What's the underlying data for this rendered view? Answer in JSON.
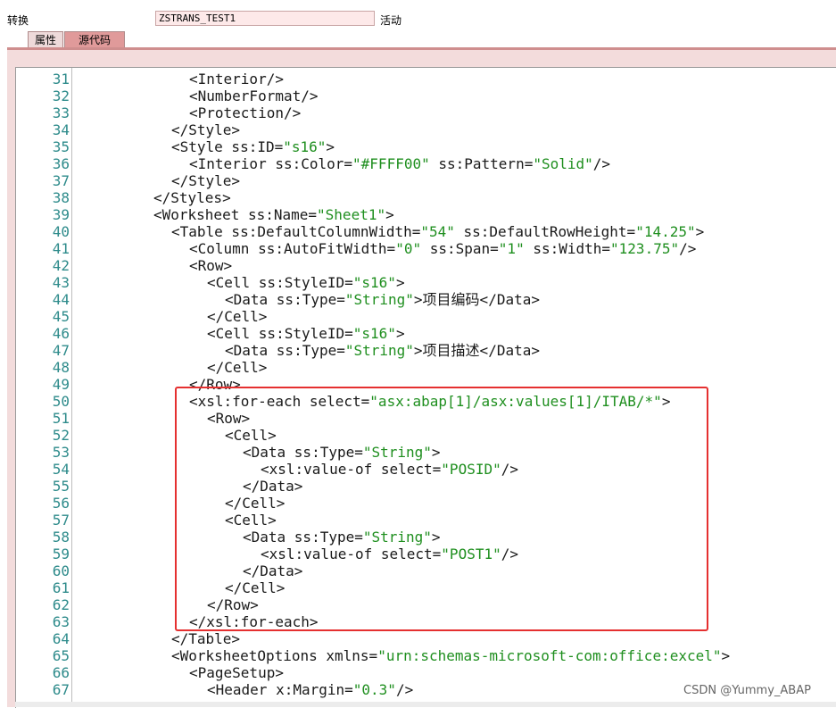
{
  "header": {
    "field_label": "转换",
    "name_value": "ZSTRANS_TEST1",
    "status": "活动"
  },
  "tabs": [
    {
      "label": "属性"
    },
    {
      "label": "源代码"
    }
  ],
  "colors": {
    "string_literal": "#1f8f1f",
    "line_number": "#2e8b8b",
    "highlight_box": "#e53030",
    "tab_active": "#e09a9a"
  },
  "code_lines": [
    {
      "n": "31",
      "indent": 6,
      "parts": [
        [
          "t",
          "<Interior/>"
        ]
      ]
    },
    {
      "n": "32",
      "indent": 6,
      "parts": [
        [
          "t",
          "<NumberFormat/>"
        ]
      ]
    },
    {
      "n": "33",
      "indent": 6,
      "parts": [
        [
          "t",
          "<Protection/>"
        ]
      ]
    },
    {
      "n": "34",
      "indent": 5,
      "parts": [
        [
          "t",
          "</Style>"
        ]
      ]
    },
    {
      "n": "35",
      "indent": 5,
      "parts": [
        [
          "t",
          "<Style ss:ID="
        ],
        [
          "s",
          "\"s16\""
        ],
        [
          "t",
          ">"
        ]
      ]
    },
    {
      "n": "36",
      "indent": 6,
      "parts": [
        [
          "t",
          "<Interior ss:Color="
        ],
        [
          "s",
          "\"#FFFF00\""
        ],
        [
          "t",
          " ss:Pattern="
        ],
        [
          "s",
          "\"Solid\""
        ],
        [
          "t",
          "/>"
        ]
      ]
    },
    {
      "n": "37",
      "indent": 5,
      "parts": [
        [
          "t",
          "</Style>"
        ]
      ]
    },
    {
      "n": "38",
      "indent": 4,
      "parts": [
        [
          "t",
          "</Styles>"
        ]
      ]
    },
    {
      "n": "39",
      "indent": 4,
      "parts": [
        [
          "t",
          "<Worksheet ss:Name="
        ],
        [
          "s",
          "\"Sheet1\""
        ],
        [
          "t",
          ">"
        ]
      ]
    },
    {
      "n": "40",
      "indent": 5,
      "parts": [
        [
          "t",
          "<Table ss:DefaultColumnWidth="
        ],
        [
          "s",
          "\"54\""
        ],
        [
          "t",
          " ss:DefaultRowHeight="
        ],
        [
          "s",
          "\"14.25\""
        ],
        [
          "t",
          ">"
        ]
      ]
    },
    {
      "n": "41",
      "indent": 6,
      "parts": [
        [
          "t",
          "<Column ss:AutoFitWidth="
        ],
        [
          "s",
          "\"0\""
        ],
        [
          "t",
          " ss:Span="
        ],
        [
          "s",
          "\"1\""
        ],
        [
          "t",
          " ss:Width="
        ],
        [
          "s",
          "\"123.75\""
        ],
        [
          "t",
          "/>"
        ]
      ]
    },
    {
      "n": "42",
      "indent": 6,
      "parts": [
        [
          "t",
          "<Row>"
        ]
      ]
    },
    {
      "n": "43",
      "indent": 7,
      "parts": [
        [
          "t",
          "<Cell ss:StyleID="
        ],
        [
          "s",
          "\"s16\""
        ],
        [
          "t",
          ">"
        ]
      ]
    },
    {
      "n": "44",
      "indent": 8,
      "parts": [
        [
          "t",
          "<Data ss:Type="
        ],
        [
          "s",
          "\"String\""
        ],
        [
          "t",
          ">项目编码</Data>"
        ]
      ]
    },
    {
      "n": "45",
      "indent": 7,
      "parts": [
        [
          "t",
          "</Cell>"
        ]
      ]
    },
    {
      "n": "46",
      "indent": 7,
      "parts": [
        [
          "t",
          "<Cell ss:StyleID="
        ],
        [
          "s",
          "\"s16\""
        ],
        [
          "t",
          ">"
        ]
      ]
    },
    {
      "n": "47",
      "indent": 8,
      "parts": [
        [
          "t",
          "<Data ss:Type="
        ],
        [
          "s",
          "\"String\""
        ],
        [
          "t",
          ">项目描述</Data>"
        ]
      ]
    },
    {
      "n": "48",
      "indent": 7,
      "parts": [
        [
          "t",
          "</Cell>"
        ]
      ]
    },
    {
      "n": "49",
      "indent": 6,
      "parts": [
        [
          "t",
          "</Row>"
        ]
      ]
    },
    {
      "n": "50",
      "indent": 6,
      "parts": [
        [
          "t",
          "<xsl:for-each select="
        ],
        [
          "s",
          "\"asx:abap[1]/asx:values[1]/ITAB/*\""
        ],
        [
          "t",
          ">"
        ]
      ]
    },
    {
      "n": "51",
      "indent": 7,
      "parts": [
        [
          "t",
          "<Row>"
        ]
      ]
    },
    {
      "n": "52",
      "indent": 8,
      "parts": [
        [
          "t",
          "<Cell>"
        ]
      ]
    },
    {
      "n": "53",
      "indent": 9,
      "parts": [
        [
          "t",
          "<Data ss:Type="
        ],
        [
          "s",
          "\"String\""
        ],
        [
          "t",
          ">"
        ]
      ]
    },
    {
      "n": "54",
      "indent": 10,
      "parts": [
        [
          "t",
          "<xsl:value-of select="
        ],
        [
          "s",
          "\"POSID\""
        ],
        [
          "t",
          "/>"
        ]
      ]
    },
    {
      "n": "55",
      "indent": 9,
      "parts": [
        [
          "t",
          "</Data>"
        ]
      ]
    },
    {
      "n": "56",
      "indent": 8,
      "parts": [
        [
          "t",
          "</Cell>"
        ]
      ]
    },
    {
      "n": "57",
      "indent": 8,
      "parts": [
        [
          "t",
          "<Cell>"
        ]
      ]
    },
    {
      "n": "58",
      "indent": 9,
      "parts": [
        [
          "t",
          "<Data ss:Type="
        ],
        [
          "s",
          "\"String\""
        ],
        [
          "t",
          ">"
        ]
      ]
    },
    {
      "n": "59",
      "indent": 10,
      "parts": [
        [
          "t",
          "<xsl:value-of select="
        ],
        [
          "s",
          "\"POST1\""
        ],
        [
          "t",
          "/>"
        ]
      ]
    },
    {
      "n": "60",
      "indent": 9,
      "parts": [
        [
          "t",
          "</Data>"
        ]
      ]
    },
    {
      "n": "61",
      "indent": 8,
      "parts": [
        [
          "t",
          "</Cell>"
        ]
      ]
    },
    {
      "n": "62",
      "indent": 7,
      "parts": [
        [
          "t",
          "</Row>"
        ]
      ]
    },
    {
      "n": "63",
      "indent": 6,
      "parts": [
        [
          "t",
          "</xsl:for-each>"
        ]
      ]
    },
    {
      "n": "64",
      "indent": 5,
      "parts": [
        [
          "t",
          "</Table>"
        ]
      ]
    },
    {
      "n": "65",
      "indent": 5,
      "parts": [
        [
          "t",
          "<WorksheetOptions xmlns="
        ],
        [
          "s",
          "\"urn:schemas-microsoft-com:office:excel\""
        ],
        [
          "t",
          ">"
        ]
      ]
    },
    {
      "n": "66",
      "indent": 6,
      "parts": [
        [
          "t",
          "<PageSetup>"
        ]
      ]
    },
    {
      "n": "67",
      "indent": 7,
      "parts": [
        [
          "t",
          "<Header x:Margin="
        ],
        [
          "s",
          "\"0.3\""
        ],
        [
          "t",
          "/>"
        ]
      ]
    }
  ],
  "watermark": "CSDN @Yummy_ABAP"
}
